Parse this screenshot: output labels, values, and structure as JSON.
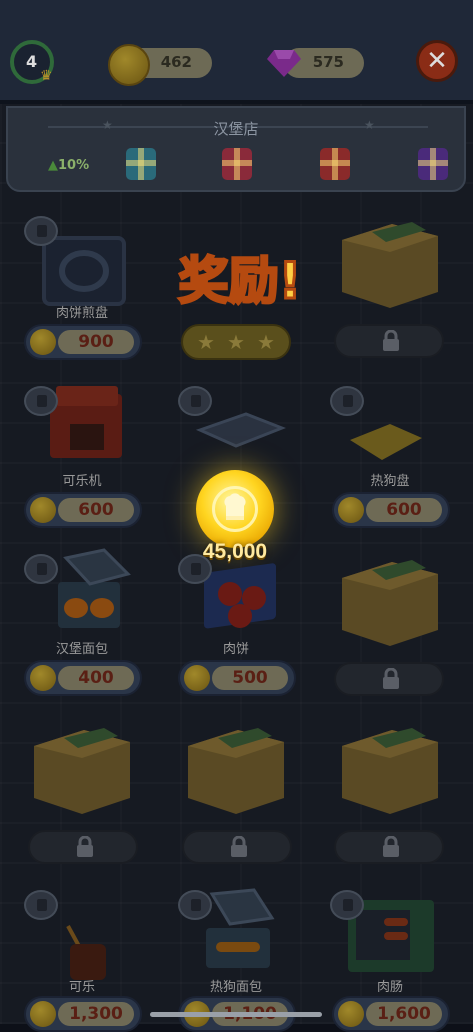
{
  "header": {
    "level": "4",
    "coins": "462",
    "gems": "575",
    "close_label": "✕"
  },
  "panel": {
    "title": "汉堡店",
    "bonus": "10%"
  },
  "reward": {
    "title": "奖励!",
    "amount": "45,000"
  },
  "items": [
    {
      "label": "肉饼煎盘",
      "price": "900",
      "state": "available"
    },
    {
      "label": "",
      "price": "",
      "state": "stars"
    },
    {
      "label": "",
      "price": "",
      "state": "locked"
    },
    {
      "label": "可乐机",
      "price": "600",
      "state": "available"
    },
    {
      "label": "",
      "price": "",
      "state": "hidden"
    },
    {
      "label": "热狗盘",
      "price": "600",
      "state": "available"
    },
    {
      "label": "汉堡面包",
      "price": "400",
      "state": "available"
    },
    {
      "label": "肉饼",
      "price": "500",
      "state": "available"
    },
    {
      "label": "",
      "price": "",
      "state": "locked"
    },
    {
      "label": "",
      "price": "",
      "state": "locked"
    },
    {
      "label": "",
      "price": "",
      "state": "locked"
    },
    {
      "label": "",
      "price": "",
      "state": "locked"
    },
    {
      "label": "可乐",
      "price": "1,300",
      "state": "available"
    },
    {
      "label": "热狗面包",
      "price": "1,100",
      "state": "available"
    },
    {
      "label": "肉肠",
      "price": "1,600",
      "state": "available"
    }
  ],
  "colors": {
    "accent_gold": "#ffd520",
    "price_text": "#5a1f14",
    "overlay": "#161a22"
  }
}
